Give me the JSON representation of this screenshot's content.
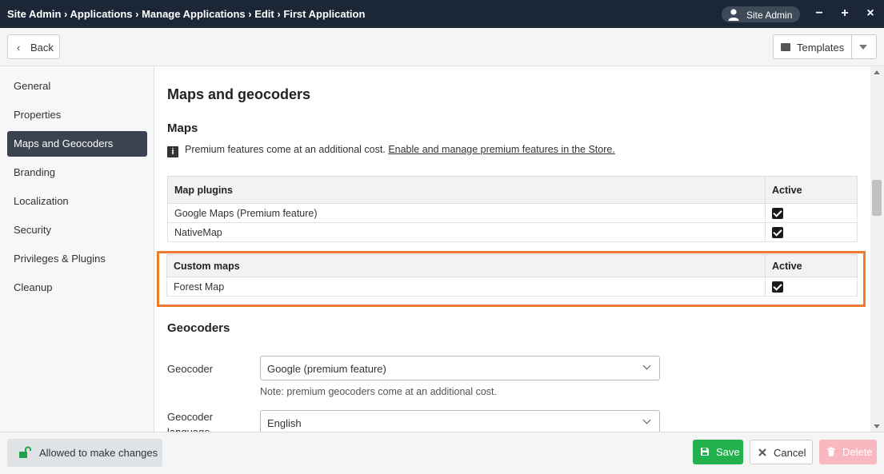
{
  "titlebar": {
    "breadcrumbs": [
      "Site Admin",
      "Applications",
      "Manage Applications",
      "Edit",
      "First Application"
    ],
    "separator": " › ",
    "user": "Site Admin",
    "minimize": "−",
    "maximize": "+",
    "close": "×"
  },
  "toolbar": {
    "back_label": "Back",
    "templates_label": "Templates"
  },
  "sidebar": {
    "items": [
      {
        "label": "General",
        "active": false
      },
      {
        "label": "Properties",
        "active": false
      },
      {
        "label": "Maps and Geocoders",
        "active": true
      },
      {
        "label": "Branding",
        "active": false
      },
      {
        "label": "Localization",
        "active": false
      },
      {
        "label": "Security",
        "active": false
      },
      {
        "label": "Privileges & Plugins",
        "active": false
      },
      {
        "label": "Cleanup",
        "active": false
      }
    ]
  },
  "main": {
    "title": "Maps and geocoders",
    "maps_heading": "Maps",
    "note_text": "Premium features come at an additional cost.",
    "note_link": "Enable and manage premium features in the Store.",
    "map_plugins": {
      "col_name": "Map plugins",
      "col_active": "Active",
      "rows": [
        {
          "name": "Google Maps (Premium feature)",
          "active": true
        },
        {
          "name": "NativeMap",
          "active": true
        }
      ]
    },
    "custom_maps": {
      "col_name": "Custom maps",
      "col_active": "Active",
      "rows": [
        {
          "name": "Forest Map",
          "active": true
        }
      ]
    },
    "geocoders_heading": "Geocoders",
    "geocoder_label": "Geocoder",
    "geocoder_value": "Google (premium feature)",
    "geocoder_note": "Note: premium geocoders come at an additional cost.",
    "geocoder_language_label": "Geocoder language",
    "geocoder_language_value": "English"
  },
  "footer": {
    "permission_label": "Allowed to make changes",
    "save_label": "Save",
    "cancel_label": "Cancel",
    "delete_label": "Delete"
  },
  "colors": {
    "titlebar": "#1b2636",
    "active_nav": "#3a4350",
    "highlight": "#f07b2e",
    "save": "#23b14d",
    "delete": "#f7b9bf",
    "lock": "#1fa34a"
  }
}
